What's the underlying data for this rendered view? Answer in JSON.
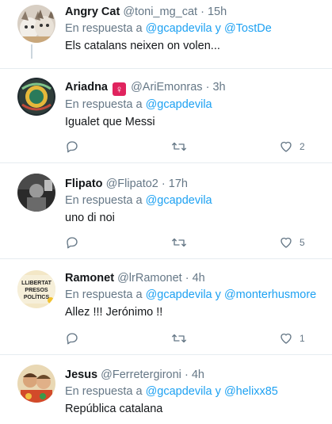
{
  "reply_prefix": "En respuesta a",
  "tweets": [
    {
      "name": "Angry Cat",
      "handle": "@toni_mg_cat",
      "time": "15h",
      "mentions": [
        "@gcapdevila",
        "@TostDe"
      ],
      "joiner": "y",
      "text": "Els catalans neixen on volen...",
      "avatar": "cat-avatar"
    },
    {
      "name": "Ariadna",
      "badge": "♀",
      "handle": "@AriEmonras",
      "time": "3h",
      "mentions": [
        "@gcapdevila"
      ],
      "text": "Igualet que Messi",
      "likes": "2",
      "avatar": "badge-avatar"
    },
    {
      "name": "Flipato",
      "handle": "@Flipato2",
      "time": "17h",
      "mentions": [
        "@gcapdevila"
      ],
      "text": "uno di noi",
      "likes": "5",
      "avatar": "bw-photo-avatar"
    },
    {
      "name": "Ramonet",
      "handle": "@lrRamonet",
      "time": "4h",
      "mentions": [
        "@gcapdevila",
        "@monterhusmore"
      ],
      "joiner": "y",
      "text": "Allez !!! Jerónimo !!",
      "likes": "1",
      "avatar": "banner-avatar"
    },
    {
      "name": "Jesus",
      "handle": "@Ferretergironi",
      "time": "4h",
      "mentions": [
        "@gcapdevila",
        "@helixx85"
      ],
      "joiner": "y",
      "text": "República catalana",
      "avatar": "kids-photo-avatar"
    }
  ],
  "colors": {
    "accent": "#1da1f2",
    "muted": "#657786",
    "divider": "#e6ecf0",
    "badge": "#e0245e"
  }
}
